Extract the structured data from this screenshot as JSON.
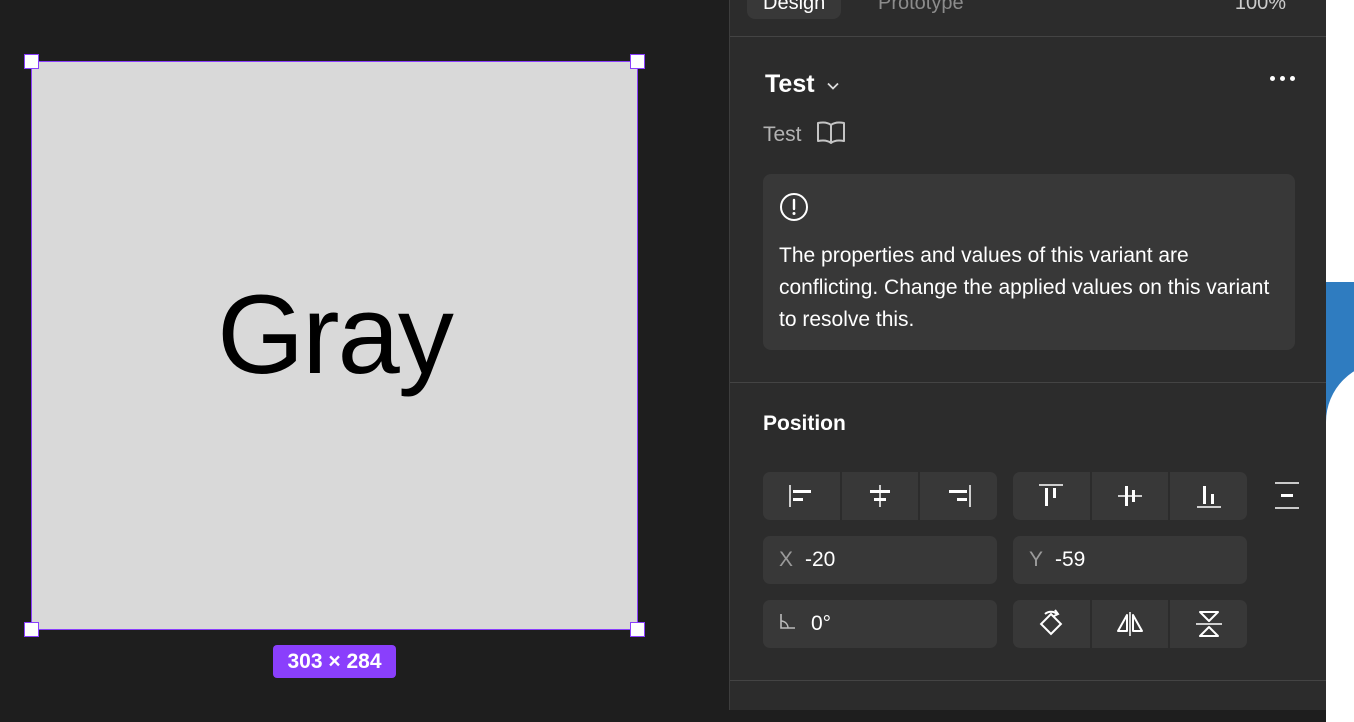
{
  "canvas": {
    "frame_text": "Gray",
    "size_badge": "303 × 284"
  },
  "panel": {
    "tabs": [
      {
        "label": "Design",
        "active": true
      },
      {
        "label": "Prototype",
        "active": false
      }
    ],
    "zoom": "100%",
    "component": {
      "title": "Test",
      "subtitle": "Test"
    },
    "warning": {
      "text": "The properties and values of this variant are conflicting. Change the applied values on this variant to resolve this."
    },
    "position": {
      "title": "Position",
      "x_label": "X",
      "x_value": "-20",
      "y_label": "Y",
      "y_value": "-59",
      "rotation_value": "0°"
    }
  },
  "colors": {
    "selection": "#8a3ffc",
    "panel_bg": "#2c2c2c",
    "canvas_bg": "#1e1e1e",
    "frame_fill": "#d9d9d9"
  },
  "icons": [
    "chevron-down-icon",
    "more-icon",
    "book-icon",
    "warning-circle-icon",
    "align-left-icon",
    "align-horizontal-center-icon",
    "align-right-icon",
    "align-top-icon",
    "align-vertical-center-icon",
    "align-bottom-icon",
    "distribute-icon",
    "angle-icon",
    "rotate-icon",
    "flip-horizontal-icon",
    "flip-vertical-icon"
  ]
}
